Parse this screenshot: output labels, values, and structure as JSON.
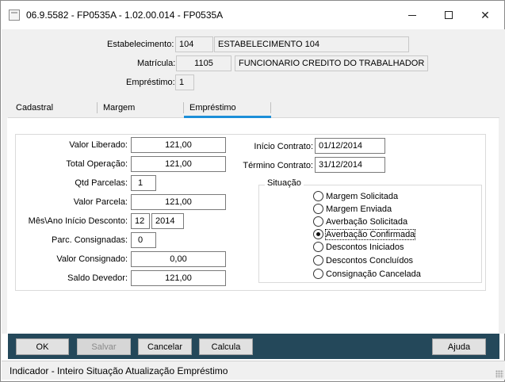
{
  "window": {
    "title": "06.9.5582 - FP0535A - 1.02.00.014 - FP0535A"
  },
  "header": {
    "estabelecimento_label": "Estabelecimento:",
    "estabelecimento_code": "104",
    "estabelecimento_name": "ESTABELECIMENTO 104",
    "matricula_label": "Matrícula:",
    "matricula_code": "1105",
    "matricula_name": "FUNCIONARIO CREDITO  DO TRABALHADOR",
    "emprestimo_label": "Empréstimo:",
    "emprestimo_value": "1"
  },
  "tabs": [
    {
      "label": "Cadastral",
      "active": false
    },
    {
      "label": "Margem",
      "active": false
    },
    {
      "label": "Empréstimo",
      "active": true
    }
  ],
  "form": {
    "valor_liberado_label": "Valor Liberado:",
    "valor_liberado": "121,00",
    "total_operacao_label": "Total Operação:",
    "total_operacao": "121,00",
    "qtd_parcelas_label": "Qtd Parcelas:",
    "qtd_parcelas": "1",
    "valor_parcela_label": "Valor Parcela:",
    "valor_parcela": "121,00",
    "mes_ano_label": "Mês\\Ano Início Desconto:",
    "mes": "12",
    "ano": "2014",
    "parc_consignadas_label": "Parc. Consignadas:",
    "parc_consignadas": "0",
    "valor_consignado_label": "Valor Consignado:",
    "valor_consignado": "0,00",
    "saldo_devedor_label": "Saldo Devedor:",
    "saldo_devedor": "121,00",
    "inicio_contrato_label": "Início Contrato:",
    "inicio_contrato": "01/12/2014",
    "termino_contrato_label": "Término Contrato:",
    "termino_contrato": "31/12/2014"
  },
  "situacao": {
    "legend": "Situação",
    "options": [
      {
        "label": "Margem Solicitada",
        "checked": false
      },
      {
        "label": "Margem Enviada",
        "checked": false
      },
      {
        "label": "Averbação Solicitada",
        "checked": false
      },
      {
        "label": "Averbação Confirmada",
        "checked": true
      },
      {
        "label": "Descontos Iniciados",
        "checked": false
      },
      {
        "label": "Descontos Concluídos",
        "checked": false
      },
      {
        "label": "Consignação Cancelada",
        "checked": false
      }
    ]
  },
  "buttons": {
    "ok": "OK",
    "salvar": "Salvar",
    "cancelar": "Cancelar",
    "calcula": "Calcula",
    "ajuda": "Ajuda"
  },
  "status": {
    "text": "Indicador - Inteiro Situação Atualização Empréstimo"
  },
  "colors": {
    "accent": "#1c8fd8",
    "button_bar": "#24485a"
  }
}
